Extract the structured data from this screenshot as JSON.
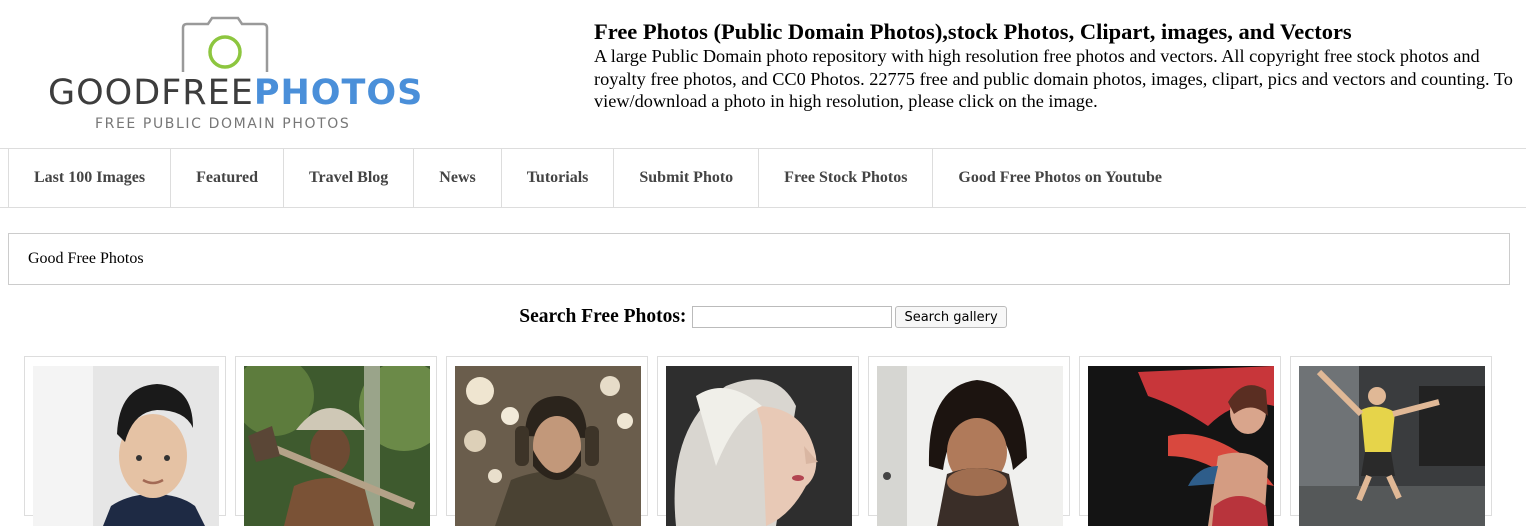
{
  "logo": {
    "word_good": "GOODFREE",
    "word_photos": "PHOTOS",
    "tagline": "FREE PUBLIC DOMAIN PHOTOS",
    "icon": "camera-icon",
    "colors": {
      "dark": "#3d3d3d",
      "blue": "#4a8fd9",
      "green": "#8dc63f"
    }
  },
  "site": {
    "title": "Free Photos (Public Domain Photos),stock Photos, Clipart, images, and Vectors",
    "description": "A large Public Domain photo repository with high resolution free photos and vectors. All copyright free stock photos and royalty free photos, and CC0 Photos. 22775 free and public domain photos, images, clipart, pics and vectors and counting. To view/download a photo in high resolution, please click on the image."
  },
  "nav": {
    "items": [
      {
        "label": "Last 100 Images"
      },
      {
        "label": "Featured"
      },
      {
        "label": "Travel Blog"
      },
      {
        "label": "News"
      },
      {
        "label": "Tutorials"
      },
      {
        "label": "Submit Photo"
      },
      {
        "label": "Free Stock Photos"
      },
      {
        "label": "Good Free Photos on Youtube"
      }
    ]
  },
  "breadcrumb": {
    "label": "Good Free Photos"
  },
  "search": {
    "label": "Search Free Photos:",
    "value": "",
    "placeholder": "",
    "button_label": "Search gallery"
  },
  "gallery": {
    "thumbnails": [
      {
        "subject": "man-portrait"
      },
      {
        "subject": "old-man-with-hat"
      },
      {
        "subject": "bearded-man-coat"
      },
      {
        "subject": "blonde-woman-profile"
      },
      {
        "subject": "woman-hands-face"
      },
      {
        "subject": "dancer-red-scarf"
      },
      {
        "subject": "skateboarder-jump"
      }
    ]
  }
}
